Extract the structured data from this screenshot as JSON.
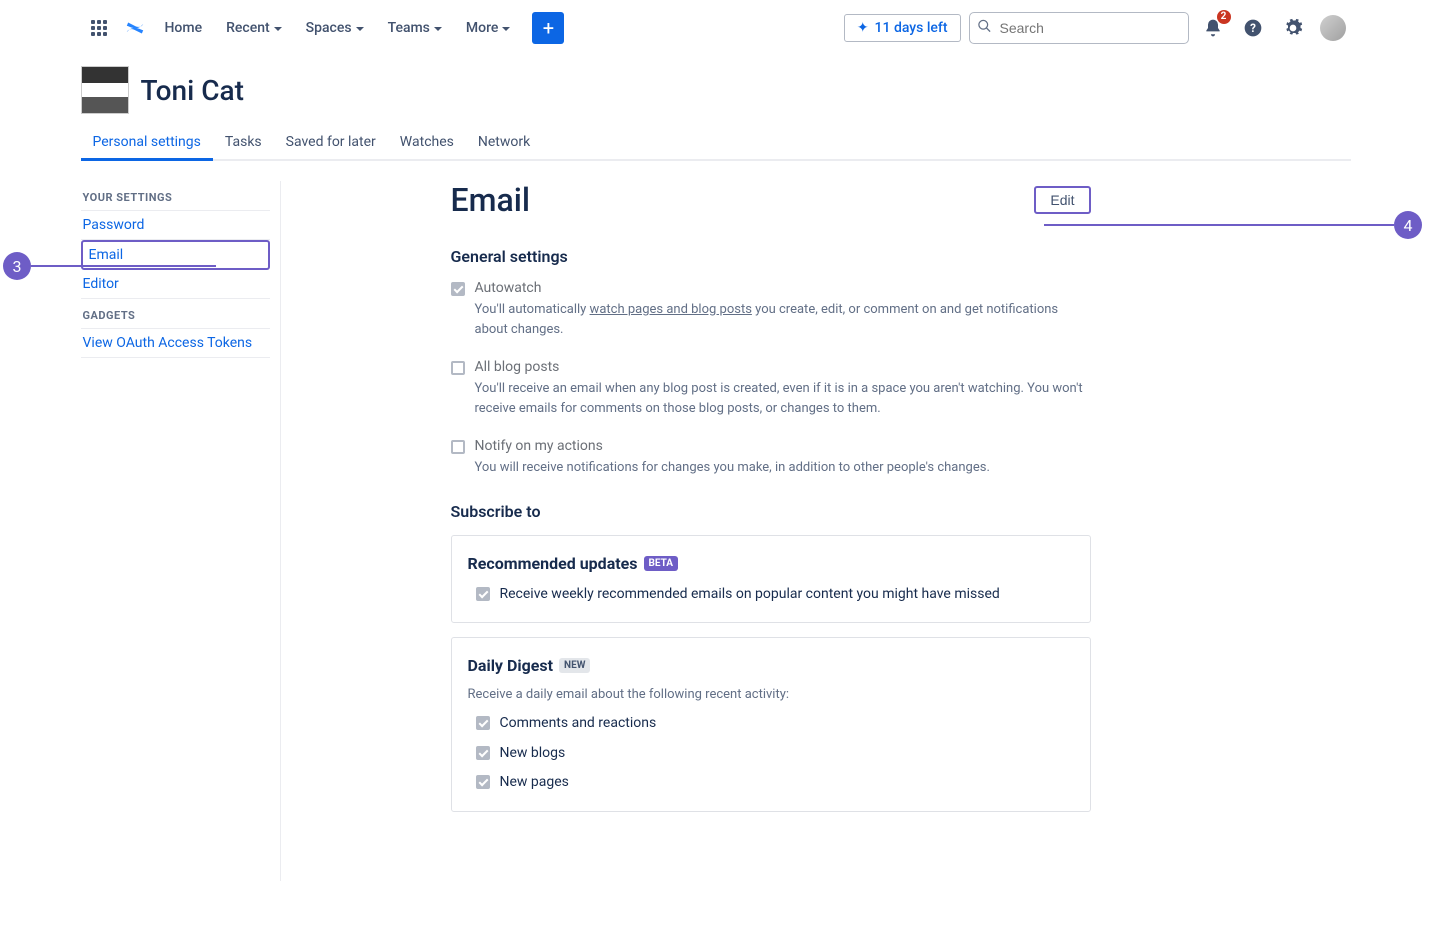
{
  "nav": {
    "home": "Home",
    "recent": "Recent",
    "spaces": "Spaces",
    "teams": "Teams",
    "more": "More",
    "trial": "11 days left",
    "search_placeholder": "Search",
    "notification_count": "2"
  },
  "profile": {
    "name": "Toni Cat"
  },
  "tabs": {
    "personal_settings": "Personal settings",
    "tasks": "Tasks",
    "saved": "Saved for later",
    "watches": "Watches",
    "network": "Network"
  },
  "sidebar": {
    "your_settings": "YOUR SETTINGS",
    "password": "Password",
    "email": "Email",
    "editor": "Editor",
    "gadgets": "GADGETS",
    "oauth": "View OAuth Access Tokens"
  },
  "main": {
    "title": "Email",
    "edit": "Edit",
    "general_settings": "General settings",
    "autowatch": {
      "label": "Autowatch",
      "desc_pre": "You'll automatically ",
      "desc_link": "watch pages and blog posts",
      "desc_post": " you create, edit, or comment on and get notifications about changes."
    },
    "all_blog": {
      "label": "All blog posts",
      "desc": "You'll receive an email when any blog post is created, even if it is in a space you aren't watching. You won't receive emails for comments on those blog posts, or changes to them."
    },
    "notify_own": {
      "label": "Notify on my actions",
      "desc": "You will receive notifications for changes you make, in addition to other people's changes."
    },
    "subscribe_to": "Subscribe to",
    "recommended": {
      "title": "Recommended updates",
      "badge": "BETA",
      "option": "Receive weekly recommended emails on popular content you might have missed"
    },
    "daily_digest": {
      "title": "Daily Digest",
      "badge": "NEW",
      "desc": "Receive a daily email about the following recent activity:",
      "comments": "Comments and reactions",
      "new_blogs": "New blogs",
      "new_pages": "New pages"
    }
  },
  "callouts": {
    "three": "3",
    "four": "4"
  }
}
